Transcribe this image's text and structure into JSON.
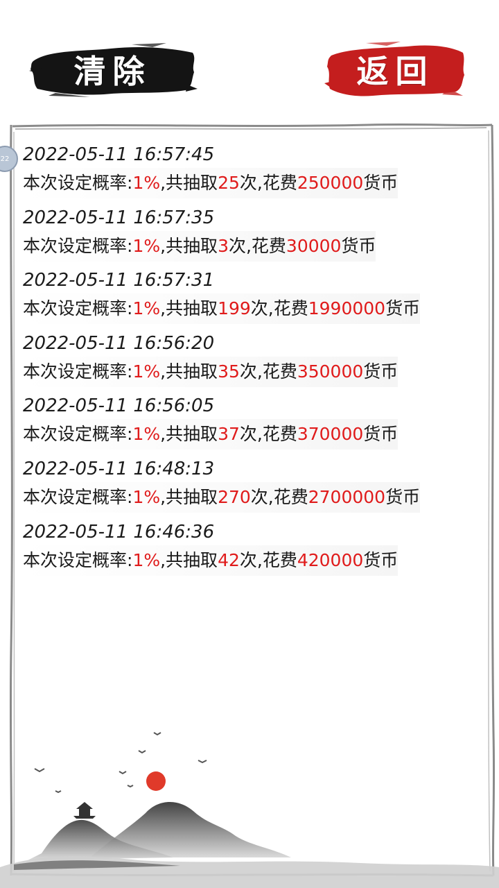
{
  "header": {
    "clear_label": "清除",
    "back_label": "返回"
  },
  "side_bubble": "22",
  "records": [
    {
      "time": "2022-05-11 16:57:45",
      "p1": "本次设定概率:",
      "rate": "1%",
      "p2": ",共抽取",
      "count": "25",
      "p3": "次,花费",
      "cost": "250000",
      "p4": "货币"
    },
    {
      "time": "2022-05-11 16:57:35",
      "p1": "本次设定概率:",
      "rate": "1%",
      "p2": ",共抽取",
      "count": "3",
      "p3": "次,花费",
      "cost": "30000",
      "p4": "货币"
    },
    {
      "time": "2022-05-11 16:57:31",
      "p1": "本次设定概率:",
      "rate": "1%",
      "p2": ",共抽取",
      "count": "199",
      "p3": "次,花费",
      "cost": "1990000",
      "p4": "货币"
    },
    {
      "time": "2022-05-11 16:56:20",
      "p1": "本次设定概率:",
      "rate": "1%",
      "p2": ",共抽取",
      "count": "35",
      "p3": "次,花费",
      "cost": "350000",
      "p4": "货币"
    },
    {
      "time": "2022-05-11 16:56:05",
      "p1": "本次设定概率:",
      "rate": "1%",
      "p2": ",共抽取",
      "count": "37",
      "p3": "次,花费",
      "cost": "370000",
      "p4": "货币"
    },
    {
      "time": "2022-05-11 16:48:13",
      "p1": "本次设定概率:",
      "rate": "1%",
      "p2": ",共抽取",
      "count": "270",
      "p3": "次,花费",
      "cost": "2700000",
      "p4": "货币"
    },
    {
      "time": "2022-05-11 16:46:36",
      "p1": "本次设定概率:",
      "rate": "1%",
      "p2": ",共抽取",
      "count": "42",
      "p3": "次,花费",
      "cost": "420000",
      "p4": "货币"
    }
  ],
  "colors": {
    "accent_red": "#e01b1b",
    "ink_black": "#141414",
    "seal_red": "#c41e1e"
  }
}
